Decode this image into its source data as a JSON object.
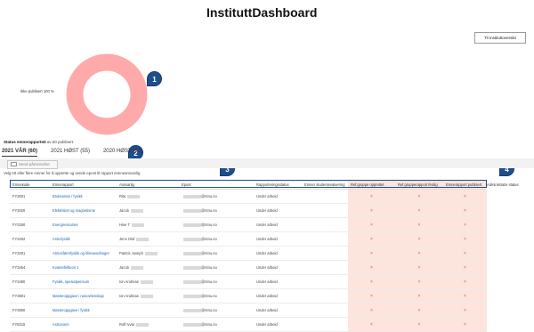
{
  "title": "InstituttDashboard",
  "overview_button": "Til Instituttoversikt",
  "donut": {
    "label": "Ikke publisert 100 %",
    "color": "#ffaaaa"
  },
  "markers": [
    "1",
    "2",
    "3",
    "4"
  ],
  "status": {
    "title": "Status emnerapporter:",
    "summary": "0 av 60 publisert."
  },
  "tabs": [
    {
      "label": "2021 VÅR (60)",
      "active": true
    },
    {
      "label": "2021 HØST (55)",
      "active": false
    },
    {
      "label": "2020 HØST (62)",
      "active": false
    }
  ],
  "send_button": "Send påminnelse",
  "hint": "Velg ett eller flere emner for å opprette og sende epost til rapport /emneansvarlig",
  "table": {
    "columns": [
      "Emnekode",
      "Emnerapport",
      "Ansvarlig",
      "Epost",
      "Rapporteringsstatus",
      "Emner studentevaluering",
      "Ref.gruppe opprettet",
      "Ref.grupperapport ferdig",
      "Emnerapport publisert"
    ],
    "admin_column": "Administrativ status",
    "rows": [
      [
        "FY3001",
        "Bruksanvis / fysikk",
        "Rita",
        "@ntnu.no",
        "Under arbeid",
        "",
        "×",
        "×",
        "×"
      ],
      [
        "FY3020",
        "Elektrisitet og magnetisme",
        "Jacob",
        "@ntnu.no",
        "Under arbeid",
        "",
        "×",
        "×",
        "×"
      ],
      [
        "FY3250",
        "Energiressurser",
        "Hine T",
        "@ntnu.no",
        "Under arbeid",
        "",
        "×",
        "×",
        "×"
      ],
      [
        "FY3402",
        "Astrofysikk",
        "Jens Oluf",
        "@ntnu.no",
        "Under arbeid",
        "",
        "×",
        "×",
        "×"
      ],
      [
        "FY3201",
        "Atmosfærefysikk og klimaendringer",
        "Patrick Joseph",
        "@ntnu.no",
        "Under arbeid",
        "",
        "×",
        "×",
        "×"
      ],
      [
        "FY3464",
        "Kvantefeltteori 1",
        "Jacob",
        "@ntnu.no",
        "Under arbeid",
        "",
        "×",
        "×",
        "×"
      ],
      [
        "FY3480",
        "Fysikk, spesialpensum",
        "Ion Andreas",
        "@ntnu.no",
        "Under arbeid",
        "",
        "×",
        "×",
        "×"
      ],
      [
        "FY3901",
        "Masteroppgave i nanovitenskap",
        "Ion Andreas",
        "@ntnu.no",
        "Under arbeid",
        "",
        "×",
        "×",
        "×"
      ],
      [
        "FY3900",
        "Masteroppgave i fysikk",
        "",
        "@ntnu.no",
        "Under arbeid",
        "",
        "×",
        "×",
        "×"
      ],
      [
        "FY8215",
        "Astronomi",
        "Rolf Ivvar",
        "@ntnu.no",
        "Under arbeid",
        "",
        "×",
        "×",
        "×"
      ]
    ]
  }
}
